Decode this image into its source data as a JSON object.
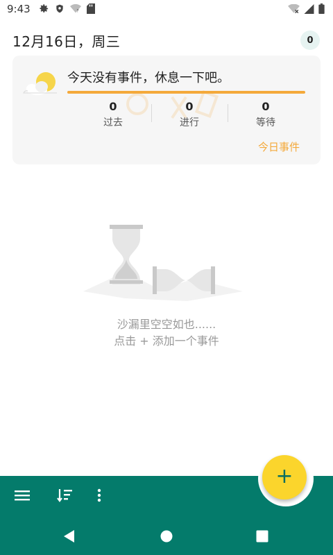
{
  "status_bar": {
    "time": "9:43",
    "left_icons": [
      "gear-icon",
      "shield-icon",
      "wifi-question-icon",
      "sd-card-icon"
    ],
    "right_icons": [
      "wifi-off-icon",
      "signal-icon",
      "battery-icon"
    ]
  },
  "header": {
    "date": "12月16日，周三",
    "count": "0"
  },
  "summary": {
    "message": "今天没有事件，休息一下吧。",
    "stats": [
      {
        "value": "0",
        "label": "过去"
      },
      {
        "value": "0",
        "label": "进行"
      },
      {
        "value": "0",
        "label": "等待"
      }
    ],
    "today_link": "今日事件",
    "accent_color": "#f4a93a"
  },
  "empty_state": {
    "line1": "沙漏里空空如也......",
    "line2": "点击 + 添加一个事件",
    "icon": "hourglass-illustration"
  },
  "fab": {
    "label": "+",
    "color": "#fbd52c"
  },
  "bottom_bar": {
    "color": "#047b6b",
    "icons": [
      "menu-icon",
      "sort-icon",
      "more-vert-icon"
    ]
  },
  "nav_bar": {
    "icons": [
      "back-icon",
      "home-icon",
      "recents-icon"
    ]
  }
}
